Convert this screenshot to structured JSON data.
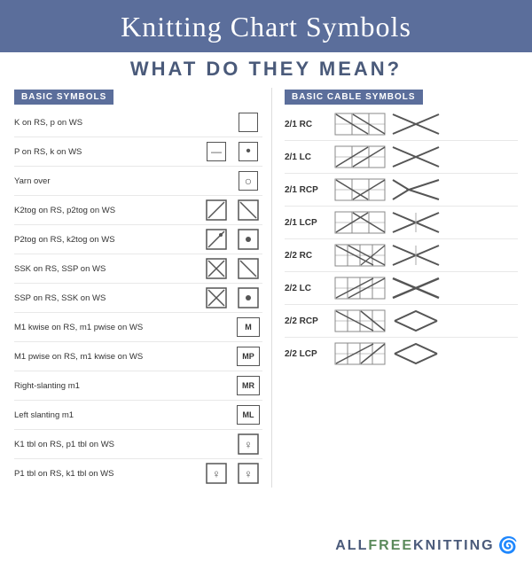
{
  "header": {
    "title": "Knitting Chart Symbols",
    "subtitle": "WHAT DO THEY MEAN?"
  },
  "basic_symbols": {
    "section_label": "BASIC SYMBOLS",
    "rows": [
      {
        "label": "K on RS, p on WS",
        "icon1": "box_empty",
        "icon2": null
      },
      {
        "label": "P on RS, k on WS",
        "icon1": "box_line",
        "icon2": "box_dot"
      },
      {
        "label": "Yarn over",
        "icon1": null,
        "icon2": "box_circle"
      },
      {
        "label": "K2tog on RS, p2tog on WS",
        "icon1": "diag_left",
        "icon2": "diag_right"
      },
      {
        "label": "P2tog on RS, k2tog on WS",
        "icon1": "diag_left_dot",
        "icon2": "box_dot_small"
      },
      {
        "label": "SSK on RS, SSP on WS",
        "icon1": "diag_left_x",
        "icon2": "diag_right_plain"
      },
      {
        "label": "SSP on RS, SSK on WS",
        "icon1": "diag_left_x2",
        "icon2": "box_dot2"
      },
      {
        "label": "M1 kwise on RS, m1 pwise on WS",
        "icon1": "box_M",
        "icon2": null
      },
      {
        "label": "M1 pwise on RS, m1 kwise on WS",
        "icon1": "box_MP",
        "icon2": null
      },
      {
        "label": "Right-slanting m1",
        "icon1": "box_MR",
        "icon2": null
      },
      {
        "label": "Left slanting m1",
        "icon1": "box_ML",
        "icon2": null
      },
      {
        "label": "K1 tbl on RS, p1 tbl on WS",
        "icon1": "tbl1",
        "icon2": null
      },
      {
        "label": "P1 tbl on RS, k1 tbl on WS",
        "icon1": "tbl2",
        "icon2": "tbl3"
      }
    ]
  },
  "cable_symbols": {
    "section_label": "BASIC CABLE SYMBOLS",
    "rows": [
      {
        "label": "2/1 RC"
      },
      {
        "label": "2/1 LC"
      },
      {
        "label": "2/1 RCP"
      },
      {
        "label": "2/1 LCP"
      },
      {
        "label": "2/2 RC"
      },
      {
        "label": "2/2 LC"
      },
      {
        "label": "2/2 RCP"
      },
      {
        "label": "2/2 LCP"
      }
    ]
  },
  "footer": {
    "text_all": "ALL",
    "text_free": "FREE",
    "text_knitting": "KNITTING"
  }
}
